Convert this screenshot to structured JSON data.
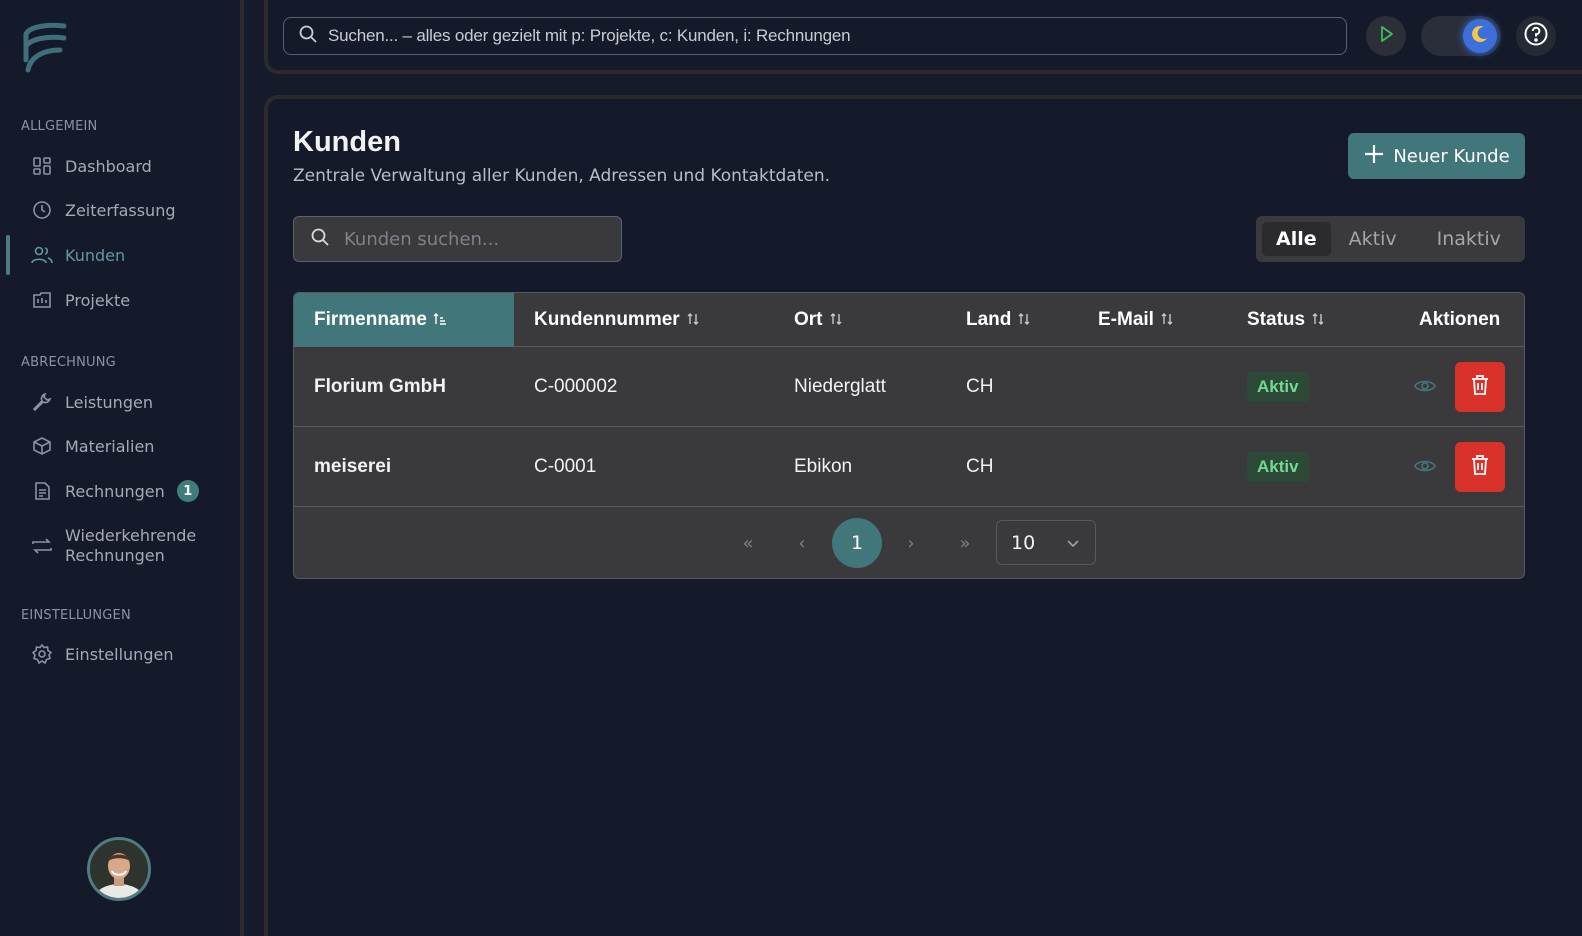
{
  "sidebar": {
    "sections": [
      {
        "title": "ALLGEMEIN"
      },
      {
        "title": "ABRECHNUNG"
      },
      {
        "title": "EINSTELLUNGEN"
      }
    ],
    "items": [
      {
        "label": "Dashboard",
        "icon": "dashboard-icon"
      },
      {
        "label": "Zeiterfassung",
        "icon": "clock-icon"
      },
      {
        "label": "Kunden",
        "icon": "users-icon",
        "active": true
      },
      {
        "label": "Projekte",
        "icon": "projects-icon"
      },
      {
        "label": "Leistungen",
        "icon": "wrench-icon"
      },
      {
        "label": "Materialien",
        "icon": "box-icon"
      },
      {
        "label": "Rechnungen",
        "icon": "invoice-icon",
        "badge": "1"
      },
      {
        "label_line1": "Wiederkehrende",
        "label_line2": "Rechnungen",
        "icon": "repeat-icon"
      },
      {
        "label": "Einstellungen",
        "icon": "gear-icon"
      }
    ]
  },
  "topbar": {
    "search_placeholder": "Suchen... – alles oder gezielt mit p: Projekte, c: Kunden, i: Rechnungen"
  },
  "page": {
    "title": "Kunden",
    "subtitle": "Zentrale Verwaltung aller Kunden, Adressen und Kontaktdaten.",
    "new_button": "Neuer Kunde",
    "search_placeholder": "Kunden suchen...",
    "filters": [
      "Alle",
      "Aktiv",
      "Inaktiv"
    ],
    "active_filter": "Alle"
  },
  "table": {
    "columns": [
      "Firmenname",
      "Kundennummer",
      "Ort",
      "Land",
      "E-Mail",
      "Status",
      "Aktionen"
    ],
    "sort_column": "Firmenname",
    "rows": [
      {
        "firmenname": "Florium GmbH",
        "kundennummer": "C-000002",
        "ort": "Niederglatt",
        "land": "CH",
        "email": "",
        "status": "Aktiv"
      },
      {
        "firmenname": "meiserei",
        "kundennummer": "C-0001",
        "ort": "Ebikon",
        "land": "CH",
        "email": "",
        "status": "Aktiv"
      }
    ]
  },
  "pagination": {
    "current_page": "1",
    "page_size": "10",
    "first": "«",
    "prev": "‹",
    "next": "›",
    "last": "»"
  },
  "colors": {
    "accent": "#41767b",
    "danger": "#d9322b",
    "success_text": "#6fdc8c",
    "background": "#141a29"
  }
}
